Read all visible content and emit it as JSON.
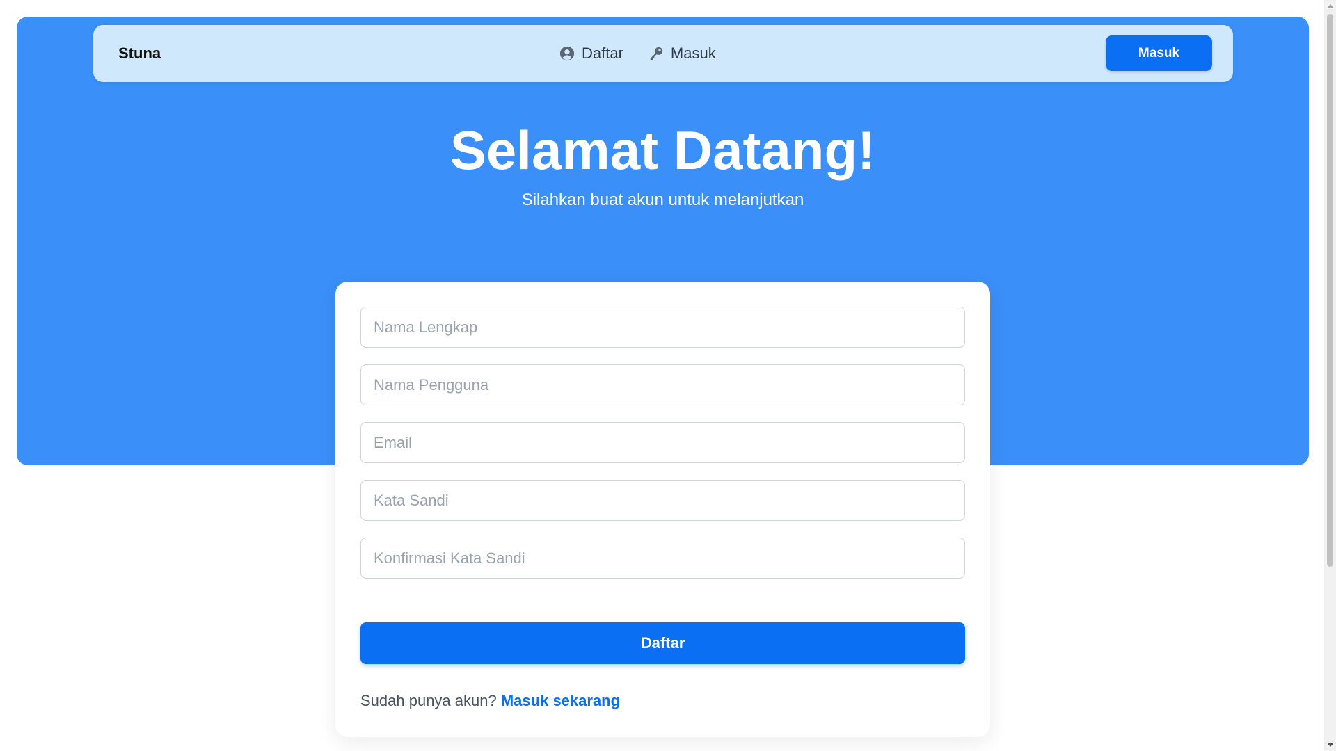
{
  "navbar": {
    "brand": "Stuna",
    "links": [
      {
        "label": "Daftar",
        "icon": "user-circle-icon"
      },
      {
        "label": "Masuk",
        "icon": "key-icon"
      }
    ],
    "button_label": "Masuk"
  },
  "hero": {
    "title": "Selamat Datang!",
    "subtitle": "Silahkan buat akun untuk melanjutkan"
  },
  "form": {
    "fields": [
      {
        "placeholder": "Nama Lengkap"
      },
      {
        "placeholder": "Nama Pengguna"
      },
      {
        "placeholder": "Email"
      },
      {
        "placeholder": "Kata Sandi"
      },
      {
        "placeholder": "Konfirmasi Kata Sandi"
      }
    ],
    "submit_label": "Daftar",
    "login_prompt": "Sudah punya akun?",
    "login_link": "Masuk sekarang"
  },
  "colors": {
    "hero_background": "#3b8ff9",
    "navbar_background": "#cfe8fb",
    "primary": "#0b6ff3"
  }
}
